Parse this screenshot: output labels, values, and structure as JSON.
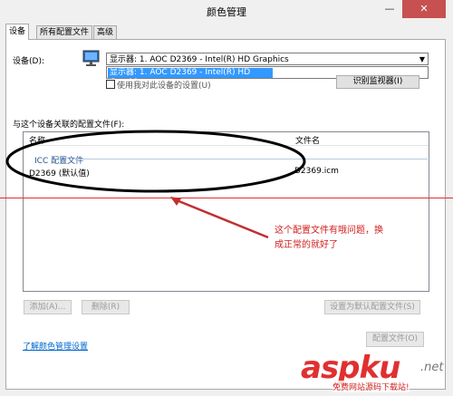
{
  "window": {
    "title": "颜色管理",
    "close_glyph": "✕",
    "minimize_glyph": "—"
  },
  "tabs": [
    {
      "label": "设备"
    },
    {
      "label": "所有配置文件"
    },
    {
      "label": "高级"
    }
  ],
  "device": {
    "label": "设备(D):",
    "selected": "显示器: 1. AOC D2369 - Intel(R) HD Graphics",
    "dropdown_option": "显示器: 1. AOC D2369 - Intel(R) HD Graphics",
    "checkbox_label": "使用我对此设备的设置(U)",
    "identify_button": "识别监视器(I)"
  },
  "profiles": {
    "section_label": "与这个设备关联的配置文件(F):",
    "columns": [
      "名称",
      "文件名"
    ],
    "group": "ICC 配置文件",
    "rows": [
      {
        "name": "D2369 (默认值)",
        "file": "D2369.icm"
      }
    ]
  },
  "buttons": {
    "add": "添加(A)...",
    "remove": "删除(R)",
    "set_default": "设置为默认配置文件(S)",
    "profiles": "配置文件(O)"
  },
  "link": "了解颜色管理设置",
  "annotation": "这个配置文件有哦问题，换成正常的就好了",
  "watermark": {
    "brand": "aspku",
    "tld": ".net",
    "tagline": "免费网站源码下载站!"
  },
  "colors": {
    "annotation": "#e03030",
    "selection": "#3399ff",
    "link": "#0066cc"
  }
}
